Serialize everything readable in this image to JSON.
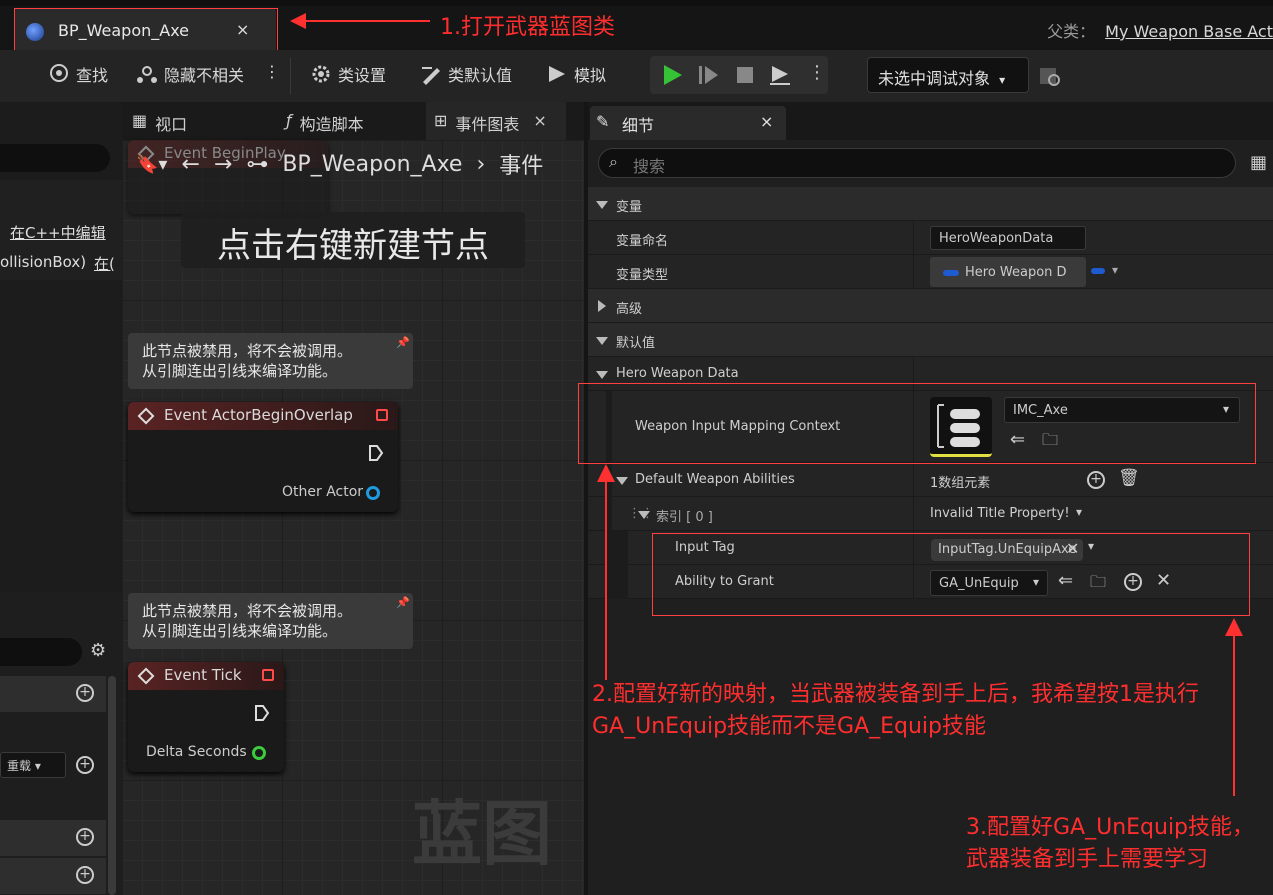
{
  "tab": {
    "title": "BP_Weapon_Axe",
    "close": "×"
  },
  "annotation1": "1.打开武器蓝图类",
  "parent": {
    "label": "父类：",
    "value": "My Weapon Base Act"
  },
  "toolbar": {
    "find": "查找",
    "hide_unrelated": "隐藏不相关",
    "class_settings": "类设置",
    "class_defaults": "类默认值",
    "simulate": "模拟",
    "debug_target": "未选中调试对象"
  },
  "left_panel": {
    "edit_cpp": "在C++中编辑",
    "collision": "ollisionBox)",
    "collision_edit": "在(",
    "override": "重载"
  },
  "graph_tabs": {
    "viewport": "视口",
    "construction": "构造脚本",
    "event_graph": "事件图表",
    "close": "×"
  },
  "graph": {
    "breadcrumb": "BP_Weapon_Axe",
    "breadcrumb_tail": "事件",
    "hint": "点击右键新建节点",
    "ghost_node": "Event BeginPlay",
    "comment1_l1": "此节点被禁用，将不会被调用。",
    "comment1_l2": "从引脚连出引线来编译功能。",
    "node1_title": "Event ActorBeginOverlap",
    "node1_pin": "Other Actor",
    "comment2_l1": "此节点被禁用，将不会被调用。",
    "comment2_l2": "从引脚连出引线来编译功能。",
    "node2_title": "Event Tick",
    "node2_pin": "Delta Seconds",
    "watermark": "蓝图"
  },
  "details": {
    "tab": "细节",
    "close": "×",
    "search_placeholder": "搜索",
    "cat_variable": "变量",
    "var_name_label": "变量命名",
    "var_name_value": "HeroWeaponData",
    "var_type_label": "变量类型",
    "var_type_value": "Hero Weapon D",
    "cat_advanced": "高级",
    "cat_default": "默认值",
    "struct_name": "Hero Weapon Data",
    "imc_label": "Weapon Input Mapping Context",
    "imc_value": "IMC_Axe",
    "abilities_label": "Default Weapon Abilities",
    "abilities_value": "1数组元素",
    "index_label": "索引 [ 0 ]",
    "index_value": "Invalid Title Property!",
    "input_tag_label": "Input Tag",
    "input_tag_value": "InputTag.UnEquipAxe",
    "ability_label": "Ability to Grant",
    "ability_value": "GA_UnEquip"
  },
  "annotation2_l1": "2.配置好新的映射，当武器被装备到手上后，我希望按1是执行",
  "annotation2_l2": "GA_UnEquip技能而不是GA_Equip技能",
  "annotation3_l1": "3.配置好GA_UnEquip技能，",
  "annotation3_l2": "武器装备到手上需要学习",
  "colors": {
    "annotation": "#ff3030",
    "play": "#36c236",
    "node_header": "#5a2323"
  }
}
